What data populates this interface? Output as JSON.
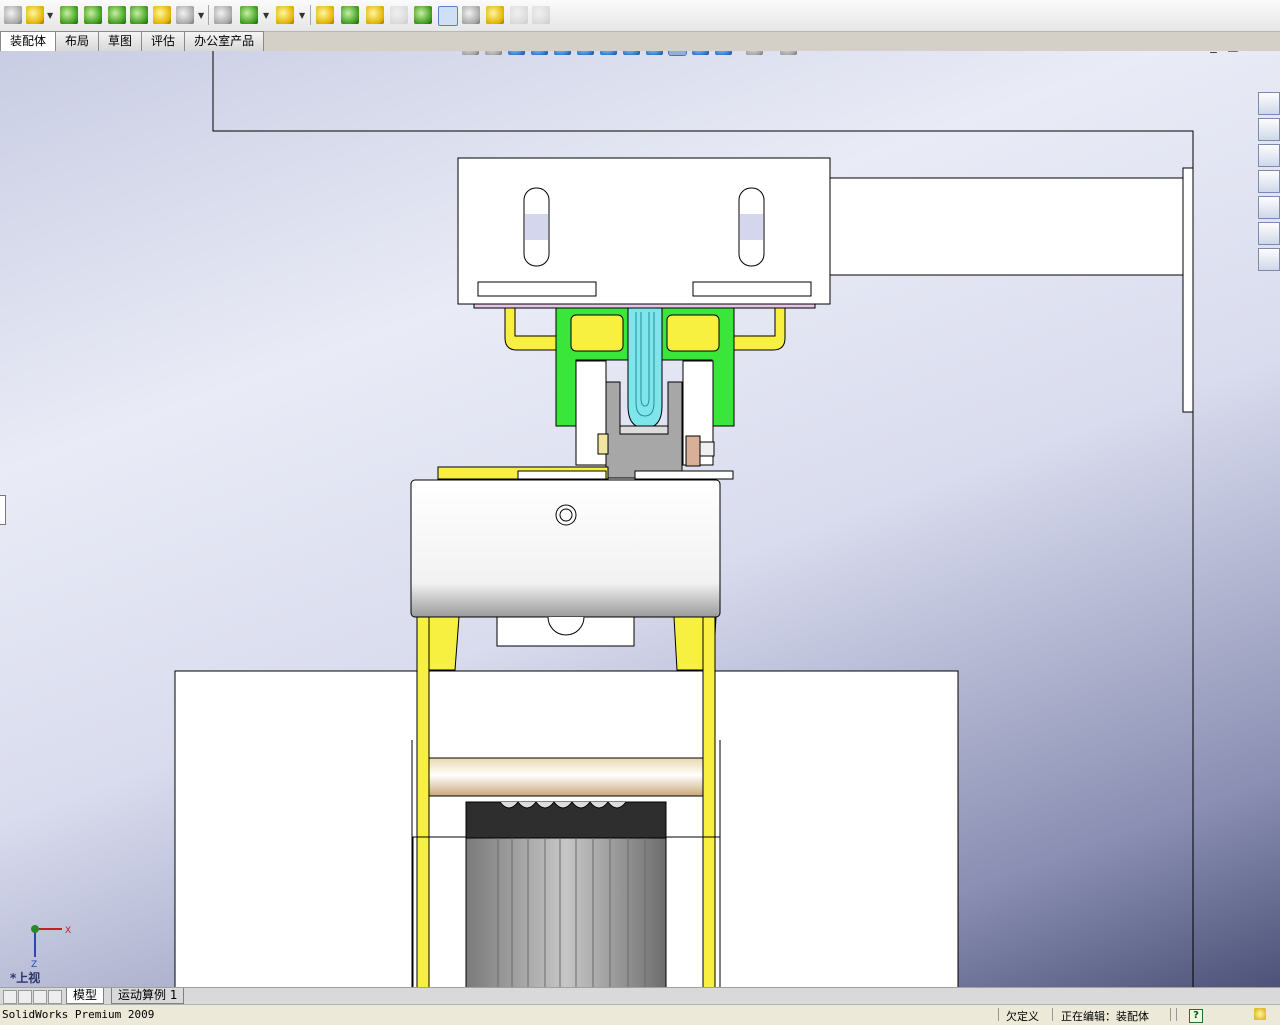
{
  "toolbar": {
    "icons": [
      "new-part-icon",
      "insert-component-icon",
      "mate-icon",
      "smart-fastener-icon",
      "linear-pattern-icon",
      "move-component-icon",
      "exploded-view-icon",
      "interference-check-icon",
      "hide-show-icon",
      "assembly-features-icon",
      "reference-geometry-icon",
      "new-motion-study-icon",
      "bill-of-materials-icon",
      "explode-line-sketch-icon",
      "instant3d-icon",
      "large-assembly-icon",
      "measure-icon",
      "rebuild-icon",
      "tool-icon",
      "simulation-icon"
    ]
  },
  "tabs": [
    "装配体",
    "布局",
    "草图",
    "评估",
    "办公室产品"
  ],
  "view_toolbar": {
    "icons": [
      "zoom-to-fit-icon",
      "zoom-to-area-icon",
      "rotate-icon",
      "pan-icon",
      "section-view-icon",
      "front-view-icon",
      "back-view-icon",
      "left-view-icon",
      "right-view-icon",
      "top-view-icon",
      "bottom-view-icon",
      "display-style-icon",
      "hide-show-items-icon",
      "view-orientation-icon"
    ],
    "selected": "top-view-icon"
  },
  "window_controls": [
    "_",
    "□",
    "✕"
  ],
  "task_pane": [
    "solidworks-resources-icon",
    "design-library-icon",
    "file-explorer-icon",
    "view-palette-icon",
    "appearances-icon",
    "custom-properties-icon",
    "search-icon"
  ],
  "triad": {
    "x_label": "X",
    "z_label": "Z"
  },
  "view_label": "*上视",
  "model_tabs": [
    "模型",
    "运动算例 1"
  ],
  "status": {
    "app_name": "SolidWorks Premium 2009",
    "definition": "欠定义",
    "editing": "正在编辑：装配体",
    "help": "?"
  },
  "colors": {
    "viewport_accent": "#8a8fb3",
    "part_yellow": "#f7f040",
    "part_green": "#39e639",
    "part_cyan": "#7ee6ea"
  }
}
